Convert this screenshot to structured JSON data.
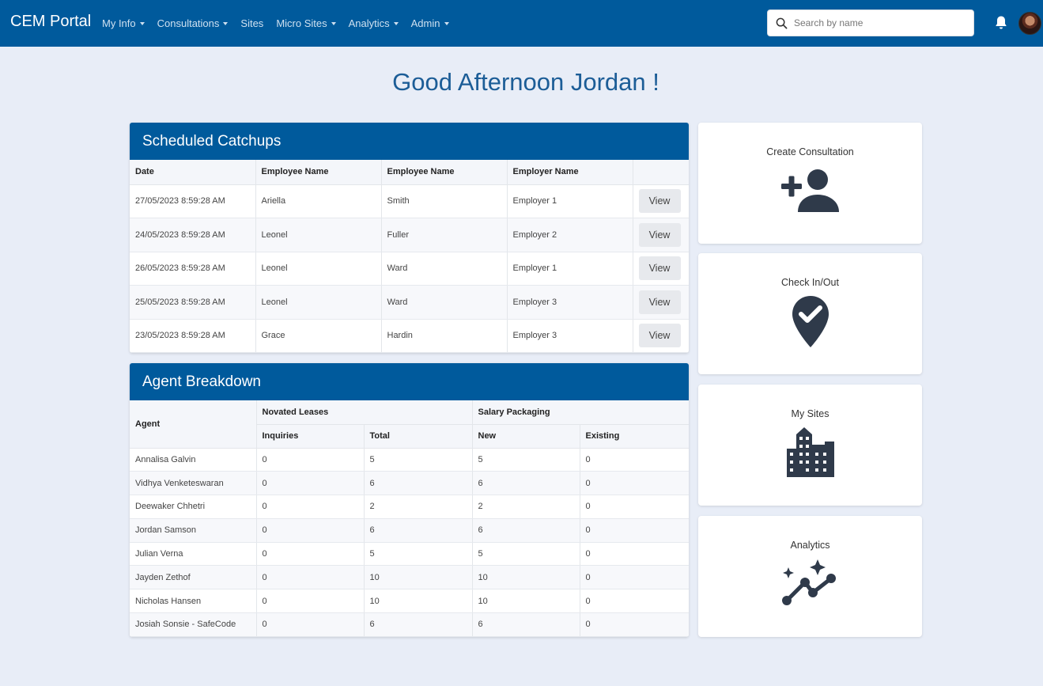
{
  "nav": {
    "brand": "CEM Portal",
    "items": [
      {
        "label": "My Info",
        "dropdown": true
      },
      {
        "label": "Consultations",
        "dropdown": true
      },
      {
        "label": "Sites",
        "dropdown": false
      },
      {
        "label": "Micro Sites",
        "dropdown": true
      },
      {
        "label": "Analytics",
        "dropdown": true
      },
      {
        "label": "Admin",
        "dropdown": true
      }
    ],
    "search_placeholder": "Search by name",
    "bell_icon": "bell-icon",
    "avatar_icon": "user-avatar"
  },
  "greeting": "Good Afternoon Jordan !",
  "catchups": {
    "title": "Scheduled Catchups",
    "columns": [
      "Date",
      "Employee Name",
      "Employee Name",
      "Employer Name",
      ""
    ],
    "rows": [
      {
        "date": "27/05/2023 8:59:28 AM",
        "first": "Ariella",
        "last": "Smith",
        "employer": "Employer 1",
        "action": "View"
      },
      {
        "date": "24/05/2023 8:59:28 AM",
        "first": "Leonel",
        "last": "Fuller",
        "employer": "Employer 2",
        "action": "View"
      },
      {
        "date": "26/05/2023 8:59:28 AM",
        "first": "Leonel",
        "last": "Ward",
        "employer": "Employer 1",
        "action": "View"
      },
      {
        "date": "25/05/2023 8:59:28 AM",
        "first": "Leonel",
        "last": "Ward",
        "employer": "Employer 3",
        "action": "View"
      },
      {
        "date": "23/05/2023 8:59:28 AM",
        "first": "Grace",
        "last": "Hardin",
        "employer": "Employer 3",
        "action": "View"
      }
    ]
  },
  "agents": {
    "title": "Agent Breakdown",
    "agent_header": "Agent",
    "group1": "Novated Leases",
    "group2": "Salary Packaging",
    "sub": [
      "Inquiries",
      "Total",
      "New",
      "Existing"
    ],
    "rows": [
      {
        "name": "Annalisa Galvin",
        "inquiries": "0",
        "total": "5",
        "new": "5",
        "existing": "0"
      },
      {
        "name": "Vidhya Venketeswaran",
        "inquiries": "0",
        "total": "6",
        "new": "6",
        "existing": "0"
      },
      {
        "name": "Deewaker Chhetri",
        "inquiries": "0",
        "total": "2",
        "new": "2",
        "existing": "0"
      },
      {
        "name": "Jordan Samson",
        "inquiries": "0",
        "total": "6",
        "new": "6",
        "existing": "0"
      },
      {
        "name": "Julian Verna",
        "inquiries": "0",
        "total": "5",
        "new": "5",
        "existing": "0"
      },
      {
        "name": "Jayden Zethof",
        "inquiries": "0",
        "total": "10",
        "new": "10",
        "existing": "0"
      },
      {
        "name": "Nicholas Hansen",
        "inquiries": "0",
        "total": "10",
        "new": "10",
        "existing": "0"
      },
      {
        "name": "Josiah Sonsie - SafeCode",
        "inquiries": "0",
        "total": "6",
        "new": "6",
        "existing": "0"
      }
    ]
  },
  "cards": [
    {
      "label": "Create Consultation",
      "icon": "add-user-icon"
    },
    {
      "label": "Check In/Out",
      "icon": "location-check-icon"
    },
    {
      "label": "My Sites",
      "icon": "building-icon"
    },
    {
      "label": "Analytics",
      "icon": "analytics-sparkle-icon"
    }
  ],
  "colors": {
    "primary": "#005a9c",
    "background": "#e8edf7",
    "greeting": "#1c5d97",
    "icon": "#2f3a4a"
  }
}
